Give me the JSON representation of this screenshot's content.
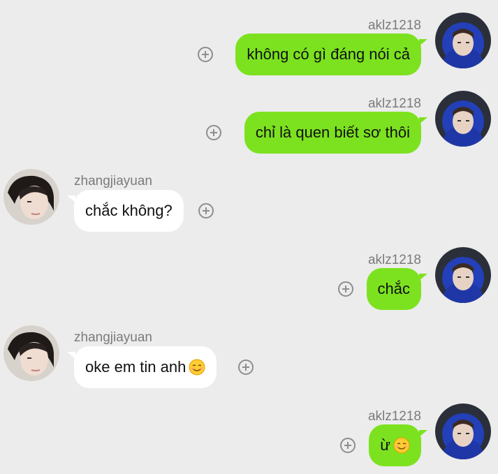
{
  "colors": {
    "background": "#ececec",
    "my_bubble": "#7ce21f",
    "their_bubble": "#ffffff",
    "username": "#7b7b7b"
  },
  "messages": [
    {
      "sender": "aklz1218",
      "side": "right",
      "text": "không có gì đáng nói cả",
      "emoji": ""
    },
    {
      "sender": "aklz1218",
      "side": "right",
      "text": "chỉ là quen biết sơ thôi",
      "emoji": ""
    },
    {
      "sender": "zhangjiayuan",
      "side": "left",
      "text": "chắc không?",
      "emoji": ""
    },
    {
      "sender": "aklz1218",
      "side": "right",
      "text": "chắc",
      "emoji": ""
    },
    {
      "sender": "zhangjiayuan",
      "side": "left",
      "text": "oke em tin anh",
      "emoji": "smiling-face-icon"
    },
    {
      "sender": "aklz1218",
      "side": "right",
      "text": "ừ",
      "emoji": "smiling-face-icon"
    }
  ]
}
